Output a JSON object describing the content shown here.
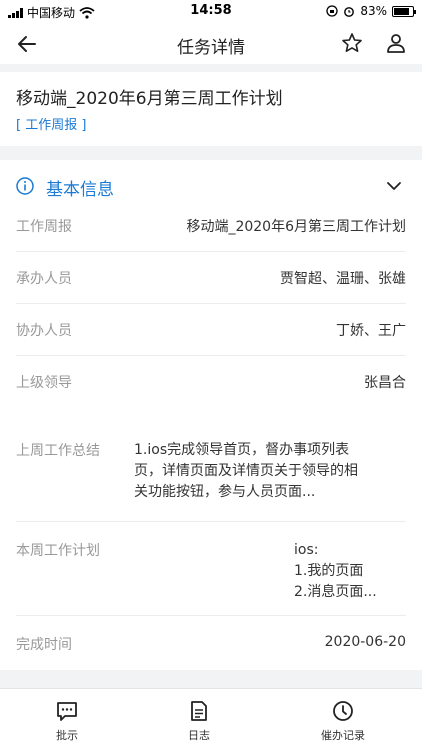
{
  "status": {
    "carrier": "中国移动",
    "time": "14:58",
    "battery_text": "83%",
    "battery_level": 0.83
  },
  "nav": {
    "title": "任务详情"
  },
  "task": {
    "title": "移动端_2020年6月第三周工作计划",
    "tag": "[ 工作周报 ]"
  },
  "info": {
    "section_title": "基本信息",
    "fields": [
      {
        "label": "工作周报",
        "value": "移动端_2020年6月第三周工作计划"
      },
      {
        "label": "承办人员",
        "value": "贾智超、温珊、张雄"
      },
      {
        "label": "协办人员",
        "value": "丁娇、王广"
      },
      {
        "label": "上级领导",
        "value": "张昌合"
      },
      {
        "label": "上周工作总结",
        "value_lines": [
          "1.ios完成领导首页，督办事项列表",
          "页，详情页面及详情页关于领导的相",
          "关功能按钮，参与人员页面..."
        ]
      },
      {
        "label": "本周工作计划",
        "value_lines": [
          "ios:",
          "1.我的页面",
          "2.消息页面..."
        ]
      },
      {
        "label": "完成时间",
        "value": "2020-06-20"
      }
    ]
  },
  "tabs": [
    {
      "label": "批示",
      "icon": "comment-icon"
    },
    {
      "label": "日志",
      "icon": "document-icon"
    },
    {
      "label": "催办记录",
      "icon": "clock-icon"
    }
  ],
  "colors": {
    "accent": "#1a7ad6",
    "label": "#999999",
    "background": "#f2f3f5"
  }
}
